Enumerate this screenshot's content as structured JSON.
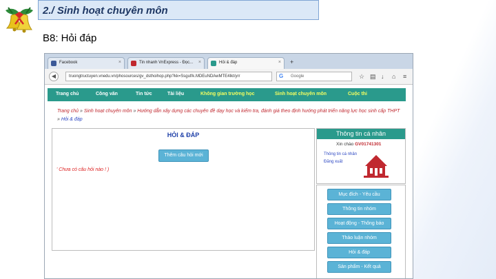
{
  "slide": {
    "title": "2./ Sinh hoạt chuyên môn",
    "subtitle": "B8: Hỏi đáp"
  },
  "browser": {
    "tabs": [
      {
        "label": "Facebook",
        "icon": "facebook-icon",
        "color": "#3b5998"
      },
      {
        "label": "Tin nhanh VnExpress - Đọc...",
        "icon": "vnexpress-icon",
        "color": "#c0282f"
      },
      {
        "label": "Hỏi & đáp",
        "icon": "page-icon",
        "color": "#2a9a8c"
      }
    ],
    "new_tab_icon": "plus-icon",
    "url": "truongtructuyen.vnedu.vn/phosources/gv_dsthoihop.php?kk=Ssguf/k.MDEuNDAwMTE4Ikt/yrr",
    "search_placeholder": "Google"
  },
  "site": {
    "nav": [
      {
        "label": "Trang chủ"
      },
      {
        "label": "Công văn"
      },
      {
        "label": "Tin tức"
      },
      {
        "label": "Tài liệu"
      },
      {
        "label": "Không gian trường học",
        "highlight": true
      },
      {
        "label": "Sinh hoạt chuyên môn",
        "highlight": true
      },
      {
        "label": "Cuộc thi",
        "highlight": true
      }
    ],
    "breadcrumb": {
      "home": "Trang chủ",
      "section": "Sinh hoạt chuyên môn",
      "topic": "Hướng dẫn xây dựng các chuyên đề dạy học và kiểm tra, đánh giá theo định hướng phát triển năng lực học sinh cấp THPT",
      "current": "Hỏi & đáp",
      "separator": "»"
    },
    "main": {
      "title": "HỎI & ĐÁP",
      "ask_button": "Thêm câu hỏi mới",
      "empty_text": "' Chưa có câu hỏi nào ! )"
    },
    "user": {
      "header": "Thông tin cá nhân",
      "greeting": "Xin chào",
      "username": "GV01741301",
      "profile_link": "Thông tin cá nhân",
      "logout_link": "Đăng xuất"
    },
    "menu": [
      "Mục đích - Yêu cầu",
      "Thông tin nhóm",
      "Hoạt động - Thông báo",
      "Thảo luận nhóm",
      "Hỏi & đáp",
      "Sản phẩm - Kết quả"
    ]
  },
  "colors": {
    "site_teal": "#2a9a8c",
    "button_blue": "#5bb3d6",
    "highlight_yellow": "#f5ff60",
    "title_bg": "#dbe8f7",
    "alert_red": "#c0282f"
  }
}
